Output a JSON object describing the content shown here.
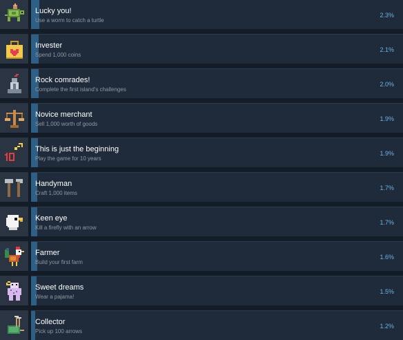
{
  "achievements": [
    {
      "title": "Lucky you!",
      "description": "Use a worm to catch a turtle",
      "percent_label": "2.3%",
      "percent": 2.3,
      "icon": "turtle-icon"
    },
    {
      "title": "Invester",
      "description": "Spend 1,000 coins",
      "percent_label": "2.1%",
      "percent": 2.1,
      "icon": "coin-bag-icon"
    },
    {
      "title": "Rock comrades!",
      "description": "Complete the first island's challenges",
      "percent_label": "2.0%",
      "percent": 2.0,
      "icon": "statue-icon"
    },
    {
      "title": "Novice merchant",
      "description": "Sell 1,000 worth of goods",
      "percent_label": "1.9%",
      "percent": 1.9,
      "icon": "scales-icon"
    },
    {
      "title": "This is just the beginning",
      "description": "Play the game for 10 years",
      "percent_label": "1.9%",
      "percent": 1.9,
      "icon": "ten-years-icon"
    },
    {
      "title": "Handyman",
      "description": "Craft 1,000 items",
      "percent_label": "1.7%",
      "percent": 1.7,
      "icon": "tools-icon"
    },
    {
      "title": "Keen eye",
      "description": "Kill a firefly with an arrow",
      "percent_label": "1.7%",
      "percent": 1.7,
      "icon": "eagle-icon"
    },
    {
      "title": "Farmer",
      "description": "Build your first farm",
      "percent_label": "1.6%",
      "percent": 1.6,
      "icon": "rooster-icon"
    },
    {
      "title": "Sweet dreams",
      "description": "Wear a pajama!",
      "percent_label": "1.5%",
      "percent": 1.5,
      "icon": "pajama-icon"
    },
    {
      "title": "Collector",
      "description": "Pick up 100 arrows",
      "percent_label": "1.2%",
      "percent": 1.2,
      "icon": "arrow-bundle-icon"
    }
  ],
  "colors": {
    "background": "#141c27",
    "row": "#1f2b3a",
    "progress_fill": "#2f5f85",
    "percent_text": "#6fb2e6",
    "title_text": "#ffffff",
    "description_text": "#8f98a5"
  }
}
